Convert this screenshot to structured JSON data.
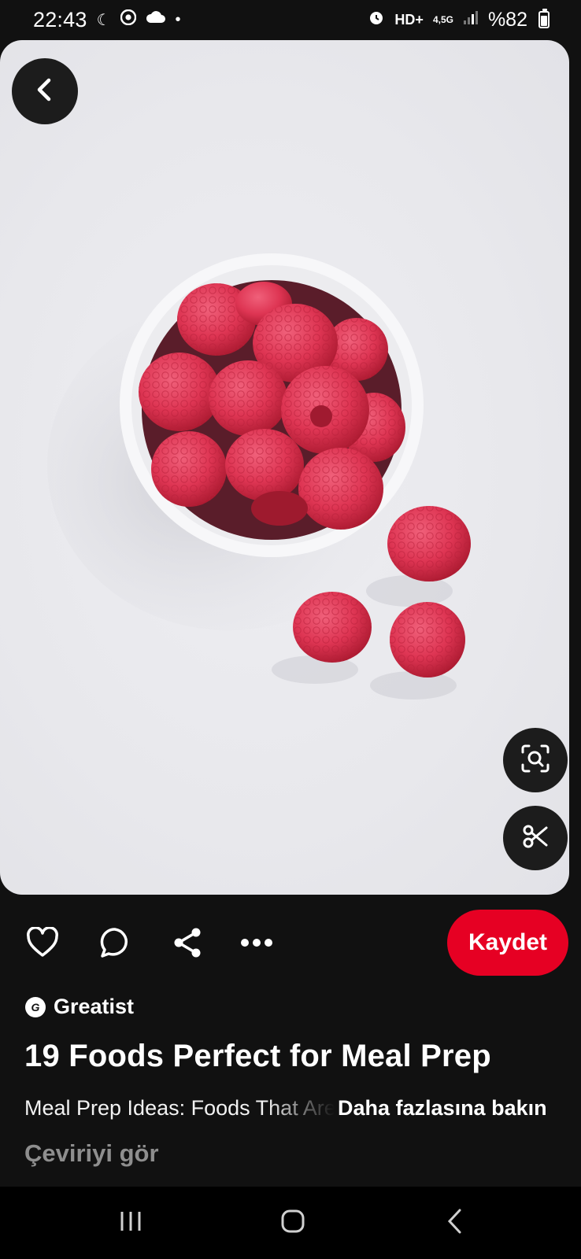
{
  "status_bar": {
    "time": "22:43",
    "network": "4,5G",
    "battery": "%82"
  },
  "pin": {
    "image_alt": "Raspberries in a white bowl",
    "actions": {
      "save_label": "Kaydet"
    },
    "source": {
      "logo_glyph": "G",
      "name": "Greatist"
    },
    "title": "19 Foods Perfect for Meal Prep",
    "description": "Meal Prep Ideas: Foods That Are Perfect",
    "more_link": "Daha fazlasına bakın",
    "translate": "Çeviriyi gör"
  },
  "icons": {
    "back": "back-arrow-icon",
    "lens": "visual-search-icon",
    "cut": "scissors-icon",
    "like": "heart-icon",
    "comment": "comment-icon",
    "share": "share-icon",
    "more": "more-icon"
  },
  "colors": {
    "save": "#e60023",
    "background": "#111111"
  }
}
